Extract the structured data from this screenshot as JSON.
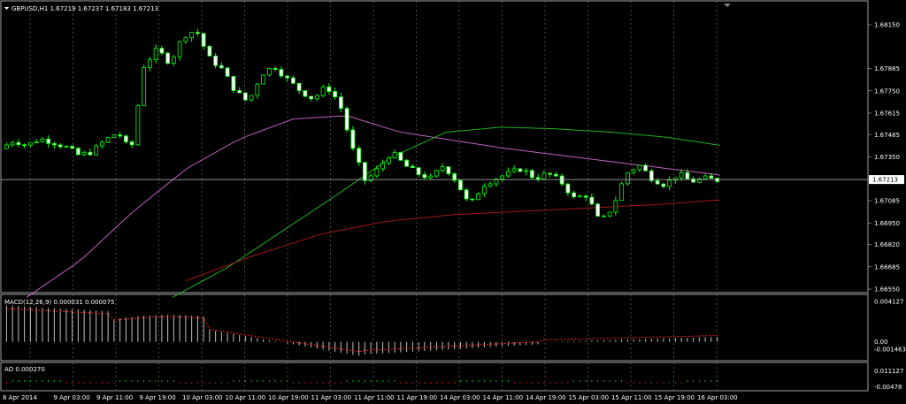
{
  "header": {
    "symbol_line": "GBPUSD,H1  1.67219 1.67237 1.67183 1.67213",
    "menu_icon": "triangle-down-icon"
  },
  "colors": {
    "background": "#000000",
    "grid": "#777777",
    "bull_candle": "#00ff00",
    "bear_candle": "#ffffff",
    "ma_fast": "#c060c0",
    "ma_mid": "#20b020",
    "ma_slow": "#a01818",
    "price_line": "#c0c0c0",
    "macd_hist": "#c0c0c0",
    "macd_signal": "#ff2020",
    "ao_up": "#00b000",
    "ao_down": "#c01010"
  },
  "chart_data": {
    "type": "candlestick",
    "symbol": "GBPUSD",
    "timeframe": "H1",
    "last_ohlc": {
      "open": 1.67219,
      "high": 1.67237,
      "low": 1.67183,
      "close": 1.67213
    },
    "current_price": 1.67213,
    "current_price_label": "1.67213",
    "price_ticks": [
      "1.68150",
      "1.67885",
      "1.67750",
      "1.67615",
      "1.67485",
      "1.67350",
      "1.67085",
      "1.66950",
      "1.66820",
      "1.66685",
      "1.66550"
    ],
    "price_tick_values": [
      1.6815,
      1.67885,
      1.6775,
      1.67615,
      1.67485,
      1.6735,
      1.67085,
      1.6695,
      1.6682,
      1.66685,
      1.6655
    ],
    "time_labels": [
      "8 Apr 2014",
      "9 Apr 03:00",
      "9 Apr 11:00",
      "9 Apr 19:00",
      "10 Apr 03:00",
      "10 Apr 11:00",
      "10 Apr 19:00",
      "11 Apr 03:00",
      "11 Apr 11:00",
      "11 Apr 19:00",
      "14 Apr 03:00",
      "14 Apr 11:00",
      "14 Apr 19:00",
      "15 Apr 03:00",
      "15 Apr 11:00",
      "15 Apr 19:00",
      "16 Apr 03:00"
    ],
    "close_path": [
      1.674,
      1.6745,
      1.6742,
      1.6746,
      1.6744,
      1.6741,
      1.6736,
      1.6738,
      1.6745,
      1.675,
      1.6738,
      1.679,
      1.68,
      1.6792,
      1.6808,
      1.6812,
      1.6795,
      1.6788,
      1.6775,
      1.6768,
      1.6785,
      1.679,
      1.6782,
      1.6775,
      1.677,
      1.6778,
      1.6768,
      1.674,
      1.672,
      1.6728,
      1.6738,
      1.673,
      1.6725,
      1.6722,
      1.673,
      1.672,
      1.6705,
      1.6718,
      1.6722,
      1.6725,
      1.6728,
      1.6722,
      1.6725,
      1.672,
      1.671,
      1.6712,
      1.6695,
      1.6705,
      1.6725,
      1.673,
      1.6722,
      1.6718,
      1.6725,
      1.672,
      1.6722,
      1.6721
    ],
    "ma_fast_path": [
      1.665,
      1.6672,
      1.6702,
      1.6728,
      1.6746,
      1.6758,
      1.676,
      1.675,
      1.6745,
      1.674,
      1.6736,
      1.6732,
      1.6728,
      1.6724
    ],
    "ma_mid_path": [
      1.665,
      1.6668,
      1.669,
      1.6712,
      1.6735,
      1.675,
      1.6753,
      1.6752,
      1.675,
      1.6747,
      1.6742
    ],
    "ma_slow_path": [
      1.666,
      1.6675,
      1.6688,
      1.6696,
      1.67,
      1.6702,
      1.6704,
      1.6706,
      1.6709
    ],
    "macd": {
      "label": "MACD(12,26,9) 0.000031 0.000075",
      "ticks": [
        "0.004127",
        "0.00",
        "-0.001463"
      ],
      "tick_values": [
        0.004127,
        0.0,
        -0.001463
      ]
    },
    "ao": {
      "label": "AO 0.000270",
      "ticks": [
        "0.011127",
        "-0.00478"
      ],
      "tick_values": [
        0.011127,
        -0.00478
      ]
    }
  }
}
